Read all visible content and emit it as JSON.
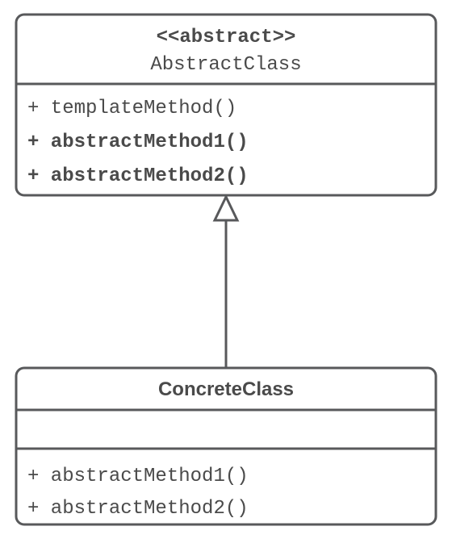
{
  "abstract": {
    "stereotype": "<<abstract>>",
    "name": "AbstractClass",
    "methods": [
      {
        "text": "+ templateMethod()",
        "bold": false
      },
      {
        "text": "+ abstractMethod1()",
        "bold": true
      },
      {
        "text": "+ abstractMethod2()",
        "bold": true
      }
    ]
  },
  "concrete": {
    "name": "ConcreteClass",
    "methods": [
      {
        "text": "+ abstractMethod1()",
        "bold": false
      },
      {
        "text": "+ abstractMethod2()",
        "bold": false
      }
    ]
  }
}
